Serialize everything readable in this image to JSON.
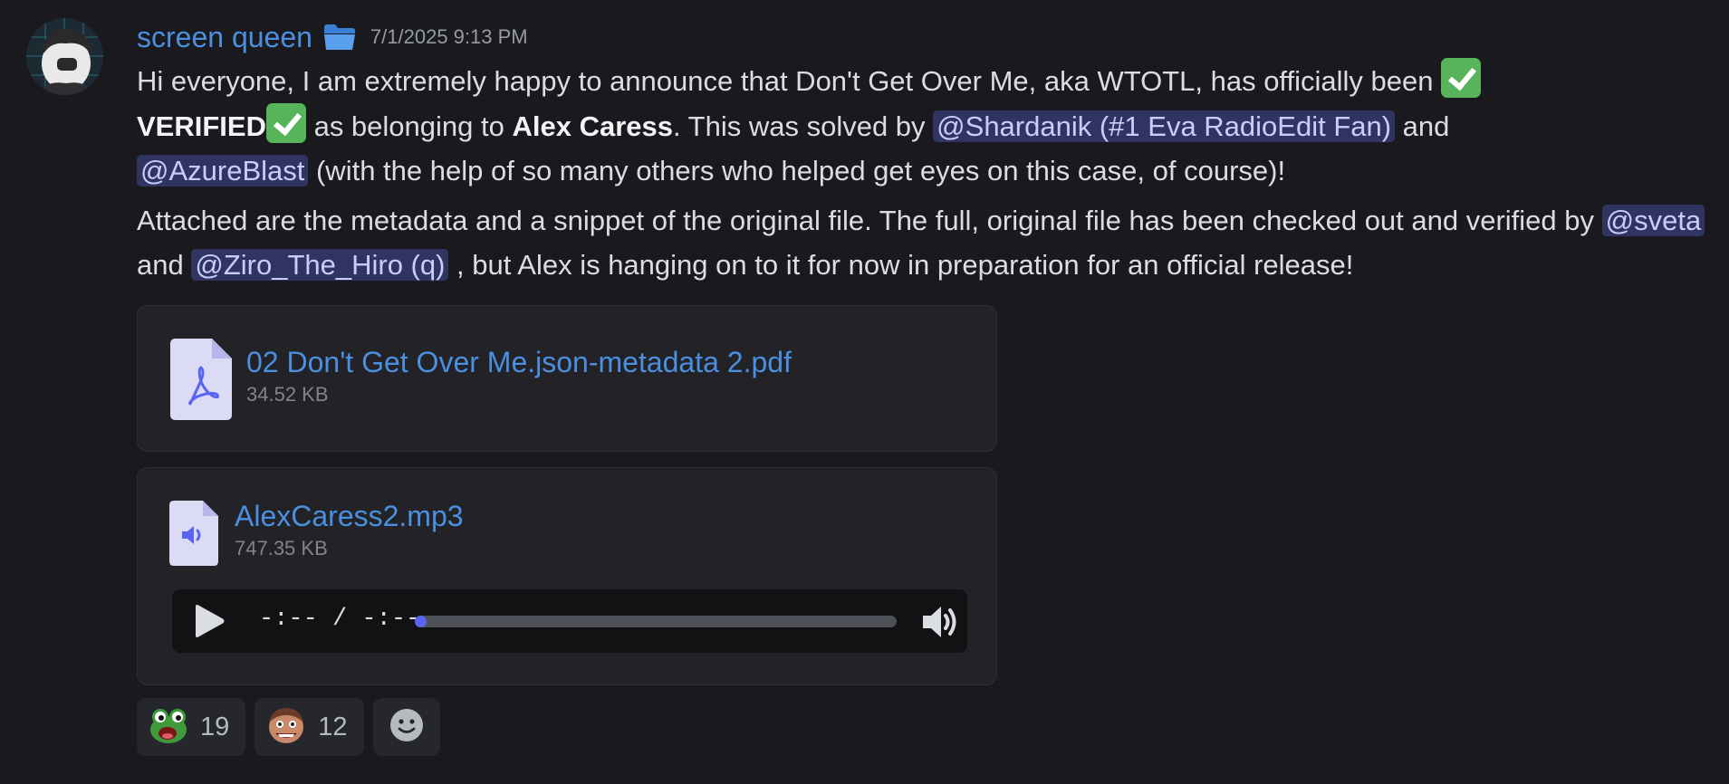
{
  "message": {
    "username": "screen queen",
    "timestamp": "7/1/2025 9:13 PM",
    "para1": {
      "t1": "Hi everyone, I am extremely happy to announce that Don't Get Over Me, aka WTOTL, has officially been ",
      "verified": "VERIFIED",
      "t2": " as belonging to ",
      "artist": "Alex Caress",
      "t3": ". This was solved by ",
      "mention1": "@Shardanik (#1 Eva RadioEdit Fan)",
      "t4": " and ",
      "mention2": "@AzureBlast",
      "t5": " (with the help of so many others who helped get eyes on this case, of course)!"
    },
    "para2": {
      "t1": "Attached are the metadata and a snippet of the original file. The full, original file has been checked out and verified by ",
      "mention1": "@sveta",
      "t2": " and ",
      "mention2": "@Ziro_The_Hiro (q)",
      "t3": " , but Alex is hanging on to it for now in preparation for an official release!"
    }
  },
  "attachments": [
    {
      "name": "02 Don't Get Over Me.json-metadata 2.pdf",
      "size": "34.52 KB",
      "icon": "pdf-file-icon"
    },
    {
      "name": "AlexCaress2.mp3",
      "size": "747.35 KB",
      "icon": "audio-file-icon"
    }
  ],
  "player": {
    "time": "-:-- / -:--",
    "progress": 0
  },
  "reactions": [
    {
      "emoji": "frog-emoji",
      "count": "19"
    },
    {
      "emoji": "character-emoji",
      "count": "12"
    }
  ],
  "colors": {
    "background": "#1a1a1e",
    "link": "#4a8fe0",
    "mention_bg": "#2f3461",
    "mention_text": "#c9cdfb",
    "check": "#57b45a",
    "accent": "#5865f2"
  }
}
